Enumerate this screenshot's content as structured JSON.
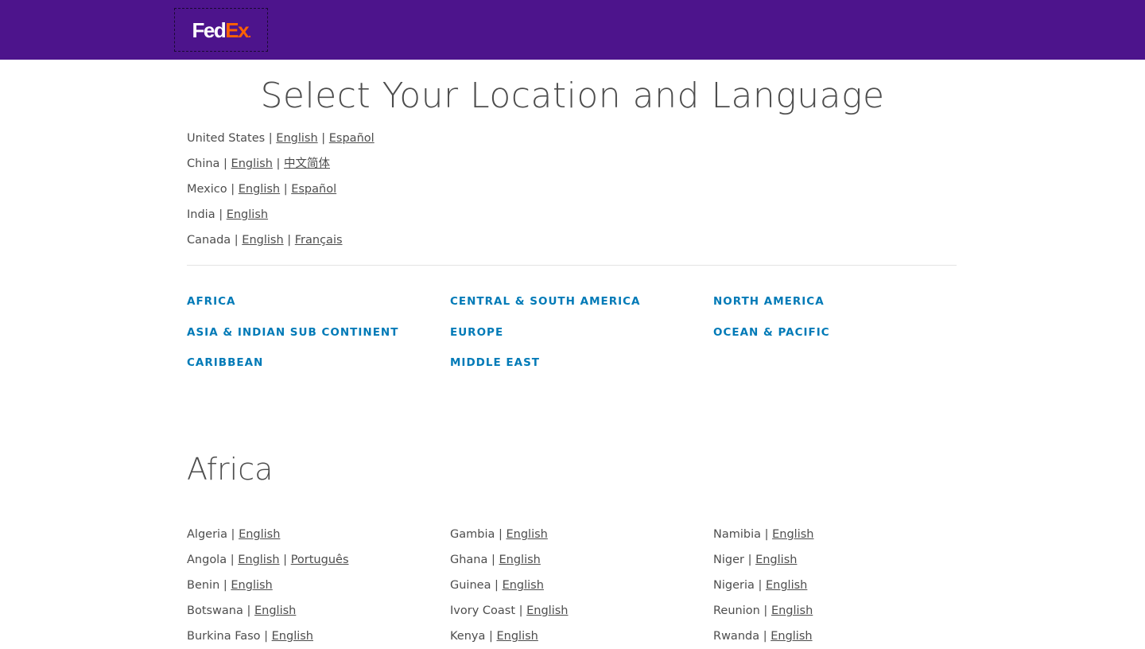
{
  "header": {
    "logo": {
      "part1": "Fed",
      "part2": "Ex",
      "dot": "."
    }
  },
  "page_title": "Select Your Location and Language",
  "quick_list": [
    {
      "country": "United States",
      "languages": [
        "English",
        "Español"
      ]
    },
    {
      "country": "China",
      "languages": [
        "English",
        "中文简体"
      ]
    },
    {
      "country": "Mexico",
      "languages": [
        "English",
        "Español"
      ]
    },
    {
      "country": "India",
      "languages": [
        "English"
      ]
    },
    {
      "country": "Canada",
      "languages": [
        "English",
        "Français"
      ]
    }
  ],
  "regions": [
    "AFRICA",
    "CENTRAL & SOUTH AMERICA",
    "NORTH AMERICA",
    "ASIA & INDIAN SUB CONTINENT",
    "EUROPE",
    "OCEAN & PACIFIC",
    "CARIBBEAN",
    "MIDDLE EAST"
  ],
  "africa": {
    "title": "Africa",
    "columns": [
      [
        {
          "country": "Algeria",
          "languages": [
            "English"
          ]
        },
        {
          "country": "Angola",
          "languages": [
            "English",
            "Português"
          ]
        },
        {
          "country": "Benin",
          "languages": [
            "English"
          ]
        },
        {
          "country": "Botswana",
          "languages": [
            "English"
          ]
        },
        {
          "country": "Burkina Faso",
          "languages": [
            "English"
          ]
        }
      ],
      [
        {
          "country": "Gambia",
          "languages": [
            "English"
          ]
        },
        {
          "country": "Ghana",
          "languages": [
            "English"
          ]
        },
        {
          "country": "Guinea",
          "languages": [
            "English"
          ]
        },
        {
          "country": "Ivory Coast",
          "languages": [
            "English"
          ]
        },
        {
          "country": "Kenya",
          "languages": [
            "English"
          ]
        }
      ],
      [
        {
          "country": "Namibia",
          "languages": [
            "English"
          ]
        },
        {
          "country": "Niger",
          "languages": [
            "English"
          ]
        },
        {
          "country": "Nigeria",
          "languages": [
            "English"
          ]
        },
        {
          "country": "Reunion",
          "languages": [
            "English"
          ]
        },
        {
          "country": "Rwanda",
          "languages": [
            "English"
          ]
        }
      ]
    ]
  },
  "colors": {
    "header_bg": "#4d148c",
    "logo_fed": "#ffffff",
    "logo_ex": "#ff6200",
    "region_link": "#007ab7",
    "text": "#4d4d4d"
  }
}
